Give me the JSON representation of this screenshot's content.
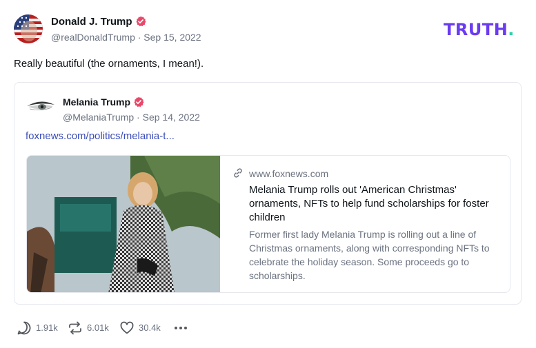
{
  "post": {
    "author_name": "Donald J. Trump",
    "author_handle_date": "@realDonaldTrump · Sep 15, 2022",
    "text": "Really beautiful (the ornaments, I mean!).",
    "brand": "TRUTH",
    "brand_dot": "."
  },
  "quote": {
    "author_name": "Melania Trump",
    "author_handle_date": "@MelaniaTrump · Sep 14, 2022",
    "link_text": "foxnews.com/politics/melania-t...",
    "card": {
      "domain": "www.foxnews.com",
      "title": "Melania Trump rolls out 'American Christmas' ornaments, NFTs to help fund scholarships for foster children",
      "description": "Former first lady Melania Trump is rolling out a line of Christmas ornaments, along with corresponding NFTs to celebrate the holiday season. Some proceeds go to scholarships."
    }
  },
  "actions": {
    "replies": "1.91k",
    "retruths": "6.01k",
    "likes": "30.4k"
  },
  "colors": {
    "brand": "#6a3bf0",
    "brand_dot": "#2ad2a8",
    "verified": "#e8486a",
    "link": "#3b4db8"
  }
}
